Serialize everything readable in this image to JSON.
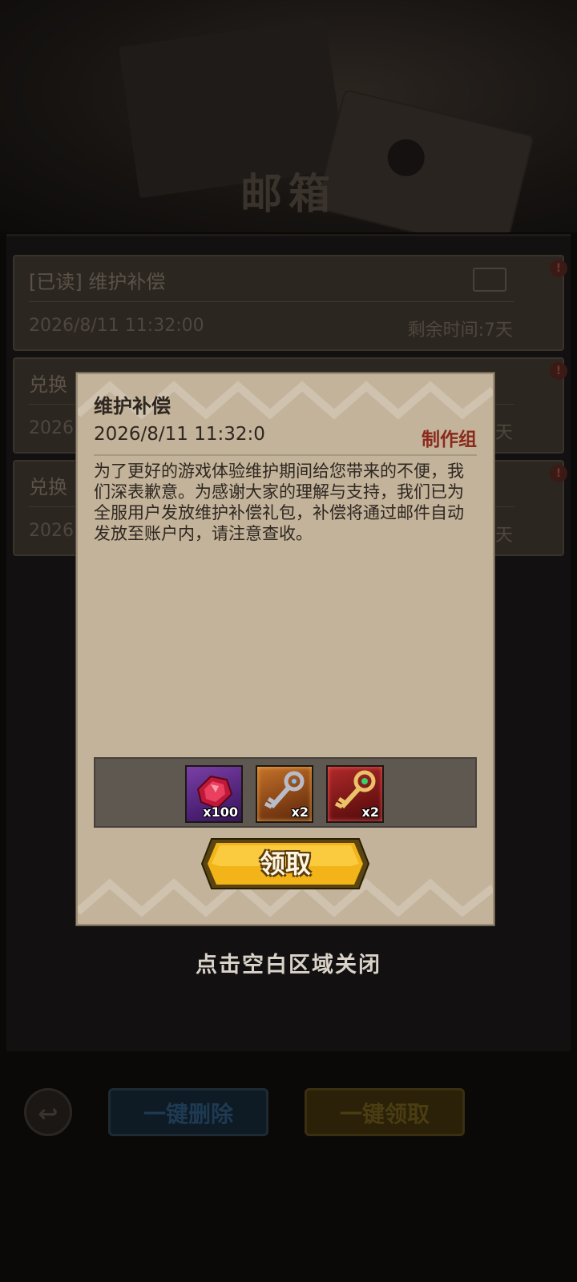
{
  "background": {
    "screen_title": "邮箱",
    "mails": [
      {
        "title": "[已读] 维护补偿",
        "date": "2026/8/11  11:32:00",
        "remaining": "剩余时间:7天",
        "badge": "!"
      },
      {
        "title": "兑换",
        "date": "2026",
        "remaining": "天",
        "badge": "!"
      },
      {
        "title": "兑换",
        "date": "2026",
        "remaining": "天",
        "badge": "!"
      }
    ],
    "buttons": {
      "back_icon": "↩",
      "delete_all": "一键删除",
      "claim_all": "一键领取"
    }
  },
  "modal": {
    "title": "维护补偿",
    "date": "2026/8/11  11:32:0",
    "sender": "制作组",
    "body": "为了更好的游戏体验维护期间给您带来的不便，我们深表歉意。为感谢大家的理解与支持，我们已为全服用户发放维护补偿礼包，补偿将通过邮件自动发放至账户内，请注意查收。",
    "rewards": [
      {
        "icon": "ruby-gem-icon",
        "quantity": "x100",
        "frame_color": "#7a3fa6"
      },
      {
        "icon": "silver-key-icon",
        "quantity": "x2",
        "frame_color": "#c5732a"
      },
      {
        "icon": "golden-key-icon",
        "quantity": "x2",
        "frame_color": "#b12a2a"
      }
    ],
    "claim_label": "领取"
  },
  "close_hint": "点击空白区域关闭",
  "colors": {
    "modal_bg": "#c2b39a",
    "sender": "#8a2a1c",
    "claim_gold": "#f2b418"
  }
}
